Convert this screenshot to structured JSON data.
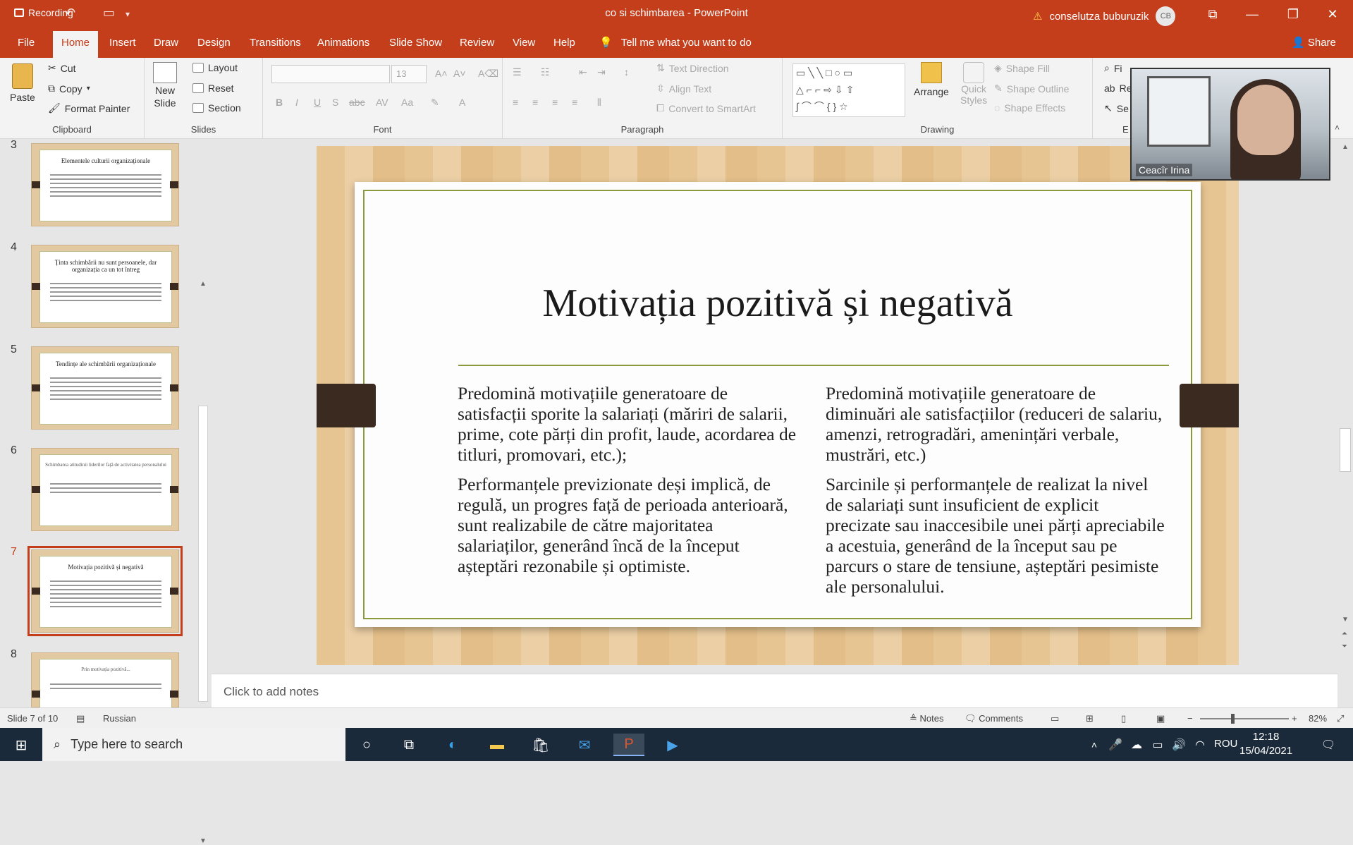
{
  "titlebar": {
    "recording": "Recording",
    "doc_title": "co si schimbarea  -  PowerPoint",
    "user": "conselutza buburuzik",
    "avatar_initials": "CB"
  },
  "tabs": [
    "File",
    "Home",
    "Insert",
    "Draw",
    "Design",
    "Transitions",
    "Animations",
    "Slide Show",
    "Review",
    "View",
    "Help"
  ],
  "tell_me": "Tell me what you want to do",
  "share": "Share",
  "ribbon": {
    "clipboard": {
      "paste": "Paste",
      "cut": "Cut",
      "copy": "Copy",
      "format_painter": "Format Painter",
      "label": "Clipboard"
    },
    "slides": {
      "new_slide_1": "New",
      "new_slide_2": "Slide",
      "layout": "Layout",
      "reset": "Reset",
      "section": "Section",
      "label": "Slides"
    },
    "font": {
      "size": "13",
      "label": "Font"
    },
    "paragraph": {
      "text_direction": "Text Direction",
      "align_text": "Align Text",
      "convert": "Convert to SmartArt",
      "label": "Paragraph"
    },
    "drawing": {
      "arrange": "Arrange",
      "quick_1": "Quick",
      "quick_2": "Styles",
      "shape_fill": "Shape Fill",
      "shape_outline": "Shape Outline",
      "shape_effects": "Shape Effects",
      "label": "Drawing"
    },
    "editing": {
      "find": "Fi",
      "replace": "Re",
      "select": "Se",
      "label": "E"
    }
  },
  "thumbnails": [
    {
      "num": "3",
      "title": "Elementele culturii organizaționale"
    },
    {
      "num": "4",
      "title": "Ținta schimbării nu sunt persoanele, dar organizația ca un tot întreg"
    },
    {
      "num": "5",
      "title": "Tendințe ale schimbării organizaționale"
    },
    {
      "num": "6",
      "title": "Schimbarea atitudinii liderilor față de activitatea personalului"
    },
    {
      "num": "7",
      "title": "Motivația pozitivă și negativă"
    },
    {
      "num": "8",
      "title": "Prin motivația pozitivă..."
    }
  ],
  "slide": {
    "title": "Motivația pozitivă și negativă",
    "left_p1": "Predomină motivațiile generatoare de satisfacții sporite la salariați (măriri de salarii, prime, cote părți din profit, laude, acordarea de titluri, promovari, etc.);",
    "left_p2": "Performanțele previzionate deși implică, de regulă, un progres față de perioada anterioară, sunt realizabile de către majoritatea salariaților, generând încă de la început așteptări rezonabile și optimiste.",
    "right_p1": "Predomină motivațiile generatoare de diminuări ale satisfacțiilor (reduceri de salariu, amenzi, retrogradări, amenințări verbale, mustrări, etc.)",
    "right_p2": "Sarcinile și performanțele de realizat la nivel de salariați sunt insuficient de explicit precizate sau inaccesibile unei părți apreciabile a acestuia, generând de la început sau pe parcurs o stare de tensiune, așteptări pesimiste ale personalului."
  },
  "webcam_name": "Ceacîr Irina",
  "notes_placeholder": "Click to add notes",
  "status": {
    "slide_count": "Slide 7 of 10",
    "language": "Russian",
    "notes": "Notes",
    "comments": "Comments",
    "zoom": "82%"
  },
  "taskbar": {
    "search_placeholder": "Type here to search",
    "lang": "ROU",
    "time": "12:18",
    "date": "15/04/2021"
  }
}
